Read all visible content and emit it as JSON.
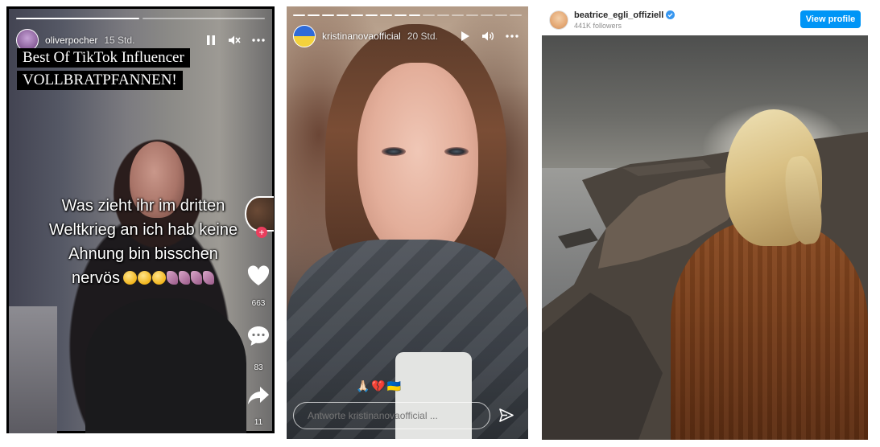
{
  "panel1": {
    "progress_total": 2,
    "progress_done": 1,
    "username": "oliverpocher",
    "time": "15 Std.",
    "icons": [
      "pause-icon",
      "mute-icon",
      "more-icon"
    ],
    "title_lines": [
      "Best Of TikTok Influencer",
      "VOLLBRATPFANNEN!"
    ],
    "caption_lines": [
      "Was zieht ihr im dritten",
      "Weltkrieg an ich hab keine",
      "Ahnung bin bisschen",
      "nervös"
    ],
    "tiktok": {
      "likes": "663",
      "comments": "83",
      "shares": "11"
    }
  },
  "panel2": {
    "progress_total": 16,
    "progress_done": 9,
    "username": "kristinanovaofficial",
    "time": "20 Std.",
    "icons": [
      "play-icon",
      "volume-icon",
      "more-icon"
    ],
    "reply_emojis": "🙏🏻💔🇺🇦",
    "reply_placeholder": "Antworte kristinanovaofficial ..."
  },
  "panel3": {
    "username": "beatrice_egli_offiziell",
    "followers": "441K followers",
    "view_profile": "View profile",
    "accent": "#0095f6"
  }
}
